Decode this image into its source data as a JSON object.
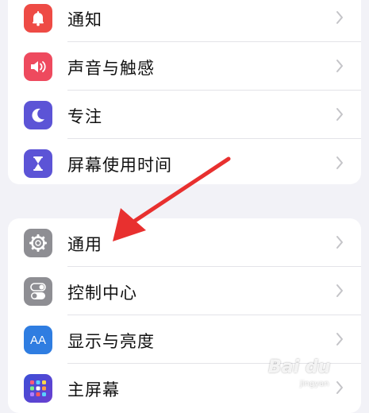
{
  "group1": {
    "items": [
      {
        "label": "通知",
        "icon": "bell-icon",
        "color": "#ee4b45"
      },
      {
        "label": "声音与触感",
        "icon": "speaker-icon",
        "color": "#ee4a5e"
      },
      {
        "label": "专注",
        "icon": "moon-icon",
        "color": "#5c54d6"
      },
      {
        "label": "屏幕使用时间",
        "icon": "hourglass-icon",
        "color": "#5c54d6"
      }
    ]
  },
  "group2": {
    "items": [
      {
        "label": "通用",
        "icon": "gear-icon",
        "color": "#8e8e93"
      },
      {
        "label": "控制中心",
        "icon": "toggle-switches-icon",
        "color": "#8e8e93"
      },
      {
        "label": "显示与亮度",
        "icon": "aa-text-icon",
        "color": "#2f7de1"
      },
      {
        "label": "主屏幕",
        "icon": "home-grid-icon",
        "color": "#3c4fd6"
      }
    ]
  },
  "aa_text": "AA",
  "annotation_arrow_color": "#e8302f",
  "watermark": {
    "text": "Bai du",
    "sub": "jingyan"
  }
}
